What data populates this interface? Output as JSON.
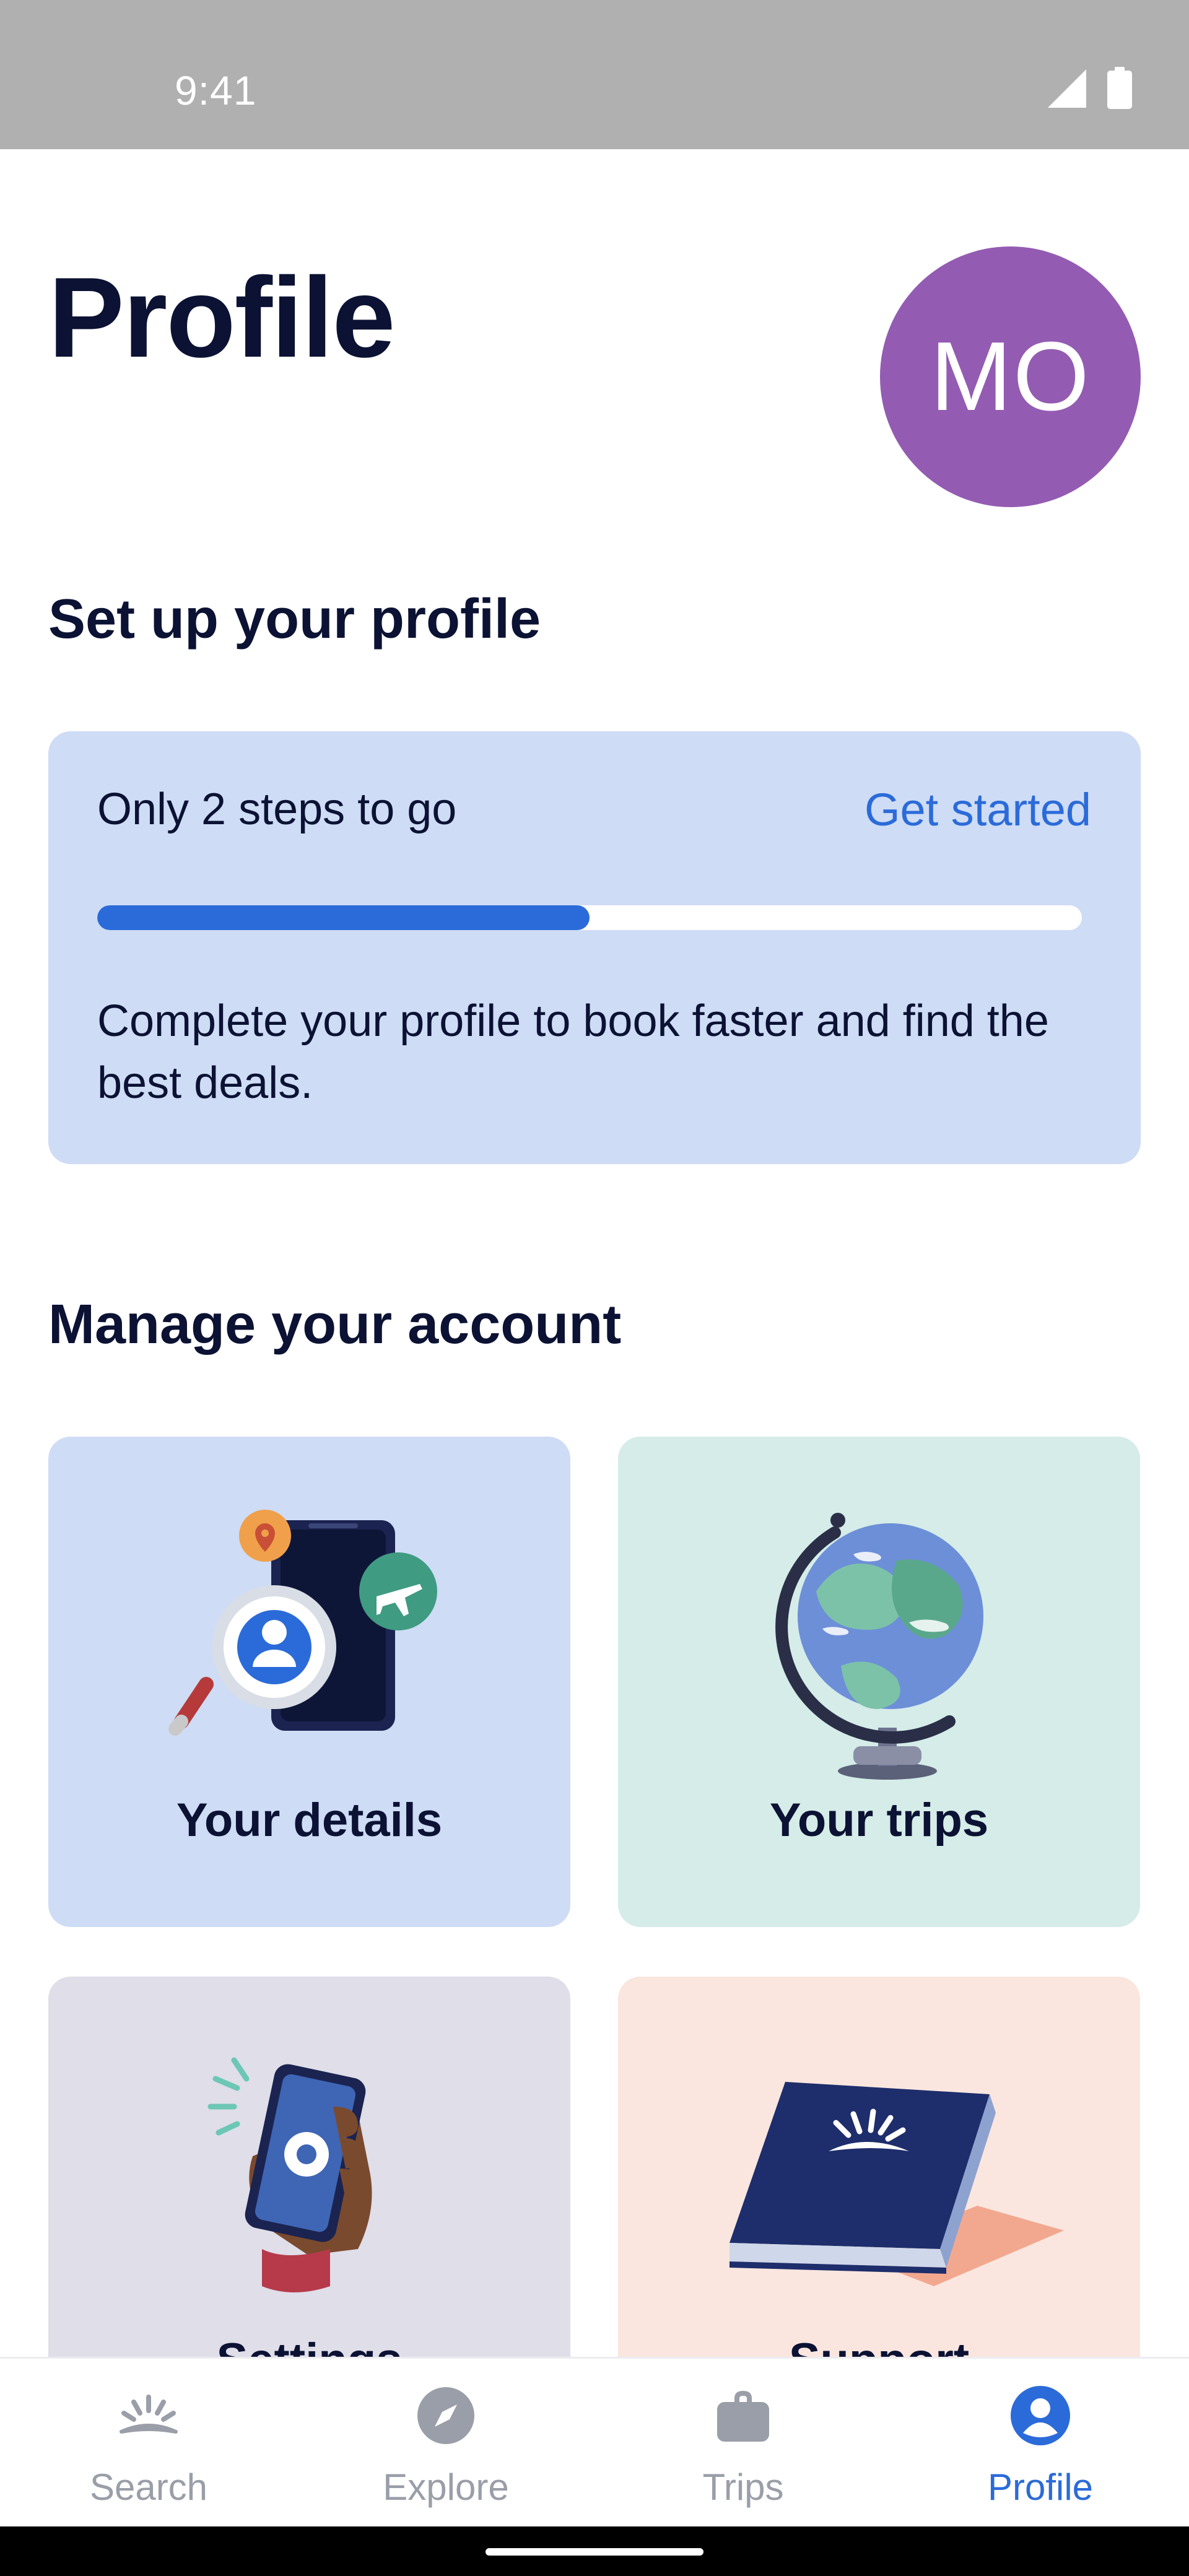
{
  "status_bar": {
    "time": "9:41",
    "icons": [
      "signal-icon",
      "battery-icon"
    ]
  },
  "header": {
    "title": "Profile",
    "avatar_initials": "MO",
    "avatar_color": "#935cb2"
  },
  "setup": {
    "heading": "Set up your profile",
    "steps_text": "Only 2 steps to go",
    "action_label": "Get started",
    "progress_fraction": 0.5,
    "description": "Complete your profile to book faster and find the best deals."
  },
  "manage": {
    "heading": "Manage your account",
    "tiles": [
      {
        "label": "Your details",
        "icon": "magnifier-phone-illustration",
        "color": "#cedcf5"
      },
      {
        "label": "Your trips",
        "icon": "globe-illustration",
        "color": "#d5ece8"
      },
      {
        "label": "Settings",
        "icon": "hand-phone-gear-illustration",
        "color": "#dfdee9"
      },
      {
        "label": "Support",
        "icon": "book-illustration",
        "color": "#fae6df"
      }
    ]
  },
  "bottom_nav": {
    "items": [
      {
        "label": "Search",
        "icon": "sunrise-icon",
        "active": false
      },
      {
        "label": "Explore",
        "icon": "compass-icon",
        "active": false
      },
      {
        "label": "Trips",
        "icon": "suitcase-icon",
        "active": false
      },
      {
        "label": "Profile",
        "icon": "person-icon",
        "active": true
      }
    ]
  },
  "colors": {
    "accent": "#2b6bd9",
    "text": "#0b1233",
    "inactive": "#9a9ea8"
  }
}
